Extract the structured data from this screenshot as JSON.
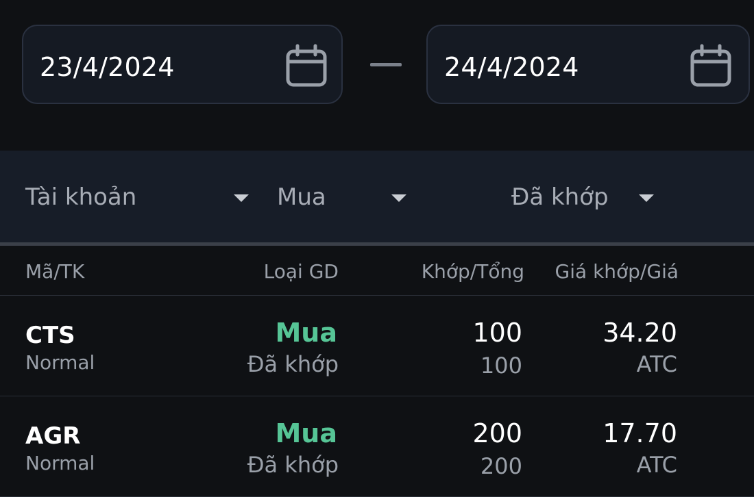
{
  "date_range": {
    "from": "23/4/2024",
    "to": "24/4/2024"
  },
  "filters": {
    "account": "Tài khoản",
    "side": "Mua",
    "status": "Đã khớp"
  },
  "table": {
    "columns": [
      "Mã/TK",
      "Loại GD",
      "Khớp/Tổng",
      "Giá khớp/Giá"
    ],
    "rows": [
      {
        "symbol": "CTS",
        "account_type": "Normal",
        "side": "Mua",
        "status": "Đã khớp",
        "matched": "100",
        "total": "100",
        "matched_price": "34.20",
        "price_type": "ATC"
      },
      {
        "symbol": "AGR",
        "account_type": "Normal",
        "side": "Mua",
        "status": "Đã khớp",
        "matched": "200",
        "total": "200",
        "matched_price": "17.70",
        "price_type": "ATC"
      }
    ]
  },
  "icons": {
    "calendar": "calendar-icon",
    "dropdown": "caret-down-icon"
  },
  "colors": {
    "background": "#0f1114",
    "buy_green": "#56c596",
    "filter_bar": "#171d28"
  }
}
